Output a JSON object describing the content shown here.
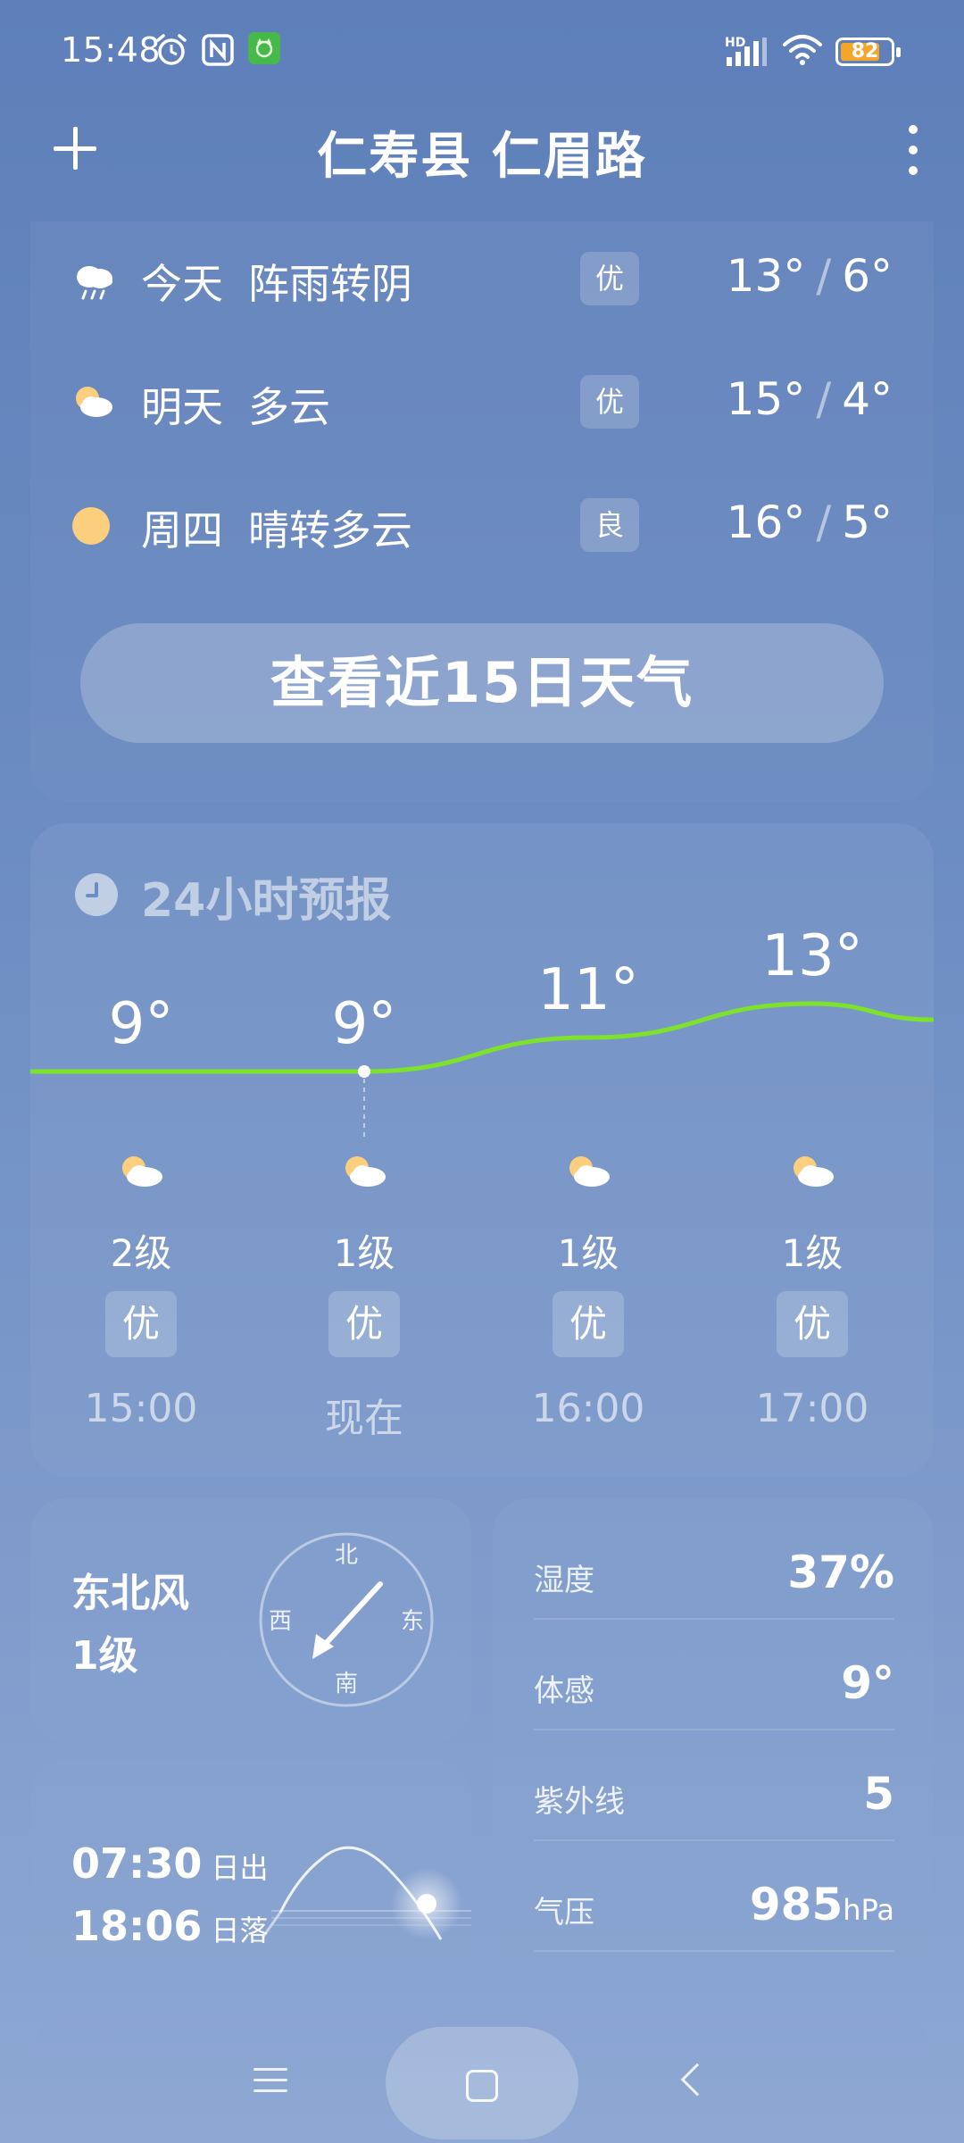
{
  "status_bar": {
    "time": "15:48",
    "network_label": "HD",
    "battery": "82",
    "battery_level": 0.82,
    "icons": [
      "alarm-icon",
      "nfc-icon",
      "app-notification-icon",
      "signal-icon",
      "wifi-icon",
      "battery-icon"
    ]
  },
  "header": {
    "title": "仁寿县 仁眉路",
    "add_icon": "plus-icon",
    "more_icon": "more-vert-icon"
  },
  "forecast": {
    "days": [
      {
        "day": "今天",
        "condition": "阵雨转阴",
        "aqi": "优",
        "high": "13°",
        "sep": "/",
        "low": "6°",
        "icon": "rain-cloud-icon"
      },
      {
        "day": "明天",
        "condition": "多云",
        "aqi": "优",
        "high": "15°",
        "sep": "/",
        "low": "4°",
        "icon": "partly-cloudy-icon"
      },
      {
        "day": "周四",
        "condition": "晴转多云",
        "aqi": "良",
        "high": "16°",
        "sep": "/",
        "low": "5°",
        "icon": "sun-icon"
      }
    ],
    "button_label": "查看近15日天气"
  },
  "hourly": {
    "title": "24小时预报",
    "items": [
      {
        "temp": "9°",
        "wind": "2级",
        "aqi": "优",
        "time": "15:00"
      },
      {
        "temp": "9°",
        "wind": "1级",
        "aqi": "优",
        "time": "现在"
      },
      {
        "temp": "11°",
        "wind": "1级",
        "aqi": "优",
        "time": "16:00"
      },
      {
        "temp": "13°",
        "wind": "1级",
        "aqi": "优",
        "time": "17:00"
      }
    ],
    "line_color": "#7ee22b"
  },
  "wind": {
    "direction": "东北风",
    "level": "1级",
    "compass": {
      "n": "北",
      "s": "南",
      "e": "东",
      "w": "西"
    }
  },
  "sun": {
    "sunrise_time": "07:30",
    "sunrise_label": "日出",
    "sunset_time": "18:06",
    "sunset_label": "日落"
  },
  "details": [
    {
      "label": "湿度",
      "value": "37%",
      "unit": ""
    },
    {
      "label": "体感",
      "value": "9°",
      "unit": ""
    },
    {
      "label": "紫外线",
      "value": "5",
      "unit": ""
    },
    {
      "label": "气压",
      "value": "985",
      "unit": "hPa"
    }
  ]
}
